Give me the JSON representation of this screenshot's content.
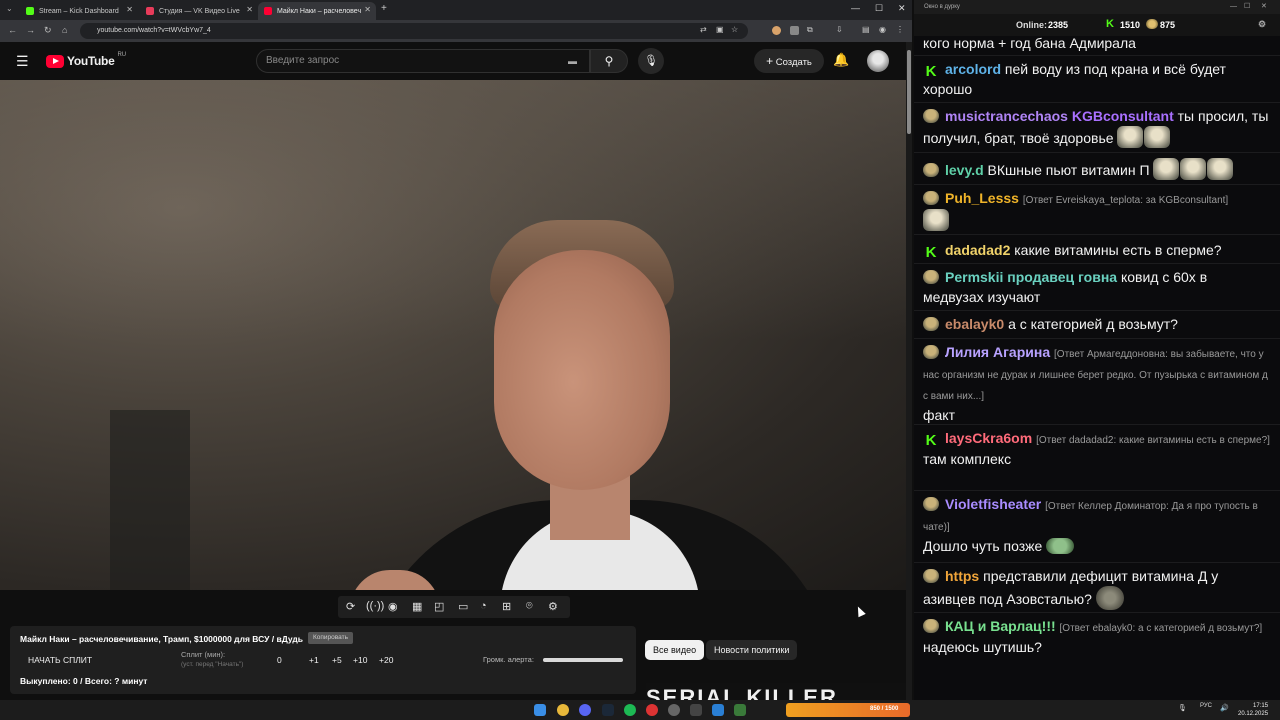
{
  "browser": {
    "tabs": [
      {
        "label": "Stream – Kick Dashboard",
        "favicon_color": "#53fc18"
      },
      {
        "label": "Студия — VK Видео Live",
        "favicon_color": "#e83b5a"
      },
      {
        "label": "Майкл Наки – расчеловеч",
        "favicon_color": "#ff0033"
      }
    ],
    "url": "youtube.com/watch?v=tWVcbYw7_4"
  },
  "youtube": {
    "logo_text": "YouTube",
    "logo_region": "RU",
    "search_placeholder": "Введите запрос",
    "create_label": "Создать"
  },
  "panel": {
    "video_title": "Майкл Наки – расчеловечивание, Трамп, $1000000 для ВСУ / вДудь",
    "copy_label": "Копировать",
    "start_split_label": "НАЧАТЬ СПЛИТ",
    "split_label": "Сплит (мин):",
    "split_hint": "(уст. перед \"Начать\")",
    "split_values": [
      "0",
      "+1",
      "+5",
      "+10",
      "+20"
    ],
    "alert_volume_label": "Громк. алерта:",
    "status_line": "Выкуплено: 0 / Всего: ? минут"
  },
  "chips": {
    "all_videos": "Все видео",
    "politics_news": "Новости политики"
  },
  "thumbnail_text": "SERIAL KILLER",
  "chat": {
    "window_title": "Окно в дурку",
    "online_label": "Online:",
    "online_count": "2385",
    "kick_count": "1510",
    "emote_count": "875",
    "messages": [
      {
        "user": "",
        "text": "кого норма + год бана Адмирала",
        "reply": ""
      },
      {
        "user": "arcolord",
        "text": "пей воду из под крана и всё будет хорошо",
        "reply": ""
      },
      {
        "user": "musictrancechaos",
        "text": "ты просил, ты получил, брат, твоё здоровье",
        "reply": "",
        "mention": "KGBconsultant"
      },
      {
        "user": "levy.d",
        "text": "ВКшные пьют витамин П",
        "reply": ""
      },
      {
        "user": "Puh_Lesss",
        "text": "",
        "reply": "[Ответ Evreiskaya_teplota: за KGBconsultant]"
      },
      {
        "user": "dadadad2",
        "text": "какие витамины есть в сперме?",
        "reply": ""
      },
      {
        "user": "Permskii продавец говна",
        "text": "ковид с 60х в медвузах изучают",
        "reply": ""
      },
      {
        "user": "ebalayk0",
        "text": "а с категорией д возьмут?",
        "reply": ""
      },
      {
        "user": "Лилия Агарина",
        "text": "факт",
        "reply": "[Ответ Армагеддоновна: вы забываете, что у нас организм не дурак и лишнее берет редко. От пузырька с витамином д с вами них...]"
      },
      {
        "user": "laysCkra6om",
        "text": "там комплекс",
        "reply": "[Ответ dadadad2: какие витамины есть в сперме?]"
      },
      {
        "user": "Violetfisheater",
        "text": "Дошло чуть позже",
        "reply": "[Ответ Келлер Доминатор: Да я про тупость в чате)]"
      },
      {
        "user": "https",
        "text": "представили дефицит витамина Д у азивцев под Азовсталью?",
        "reply": ""
      },
      {
        "user": "КАЦ и Варлац!!!",
        "text": "надеюсь шутишь?",
        "reply": "[Ответ ebalayk0: а с категорией д возьмут?]"
      }
    ],
    "colors": {
      "arcolord": "#5fb3e8",
      "musictrancechaos": "#b084f5",
      "mention": "#a970ff",
      "levy": "#5fd0a8",
      "puh": "#f0b429",
      "dadadad2": "#f0d26a",
      "permskii": "#6ad1c0",
      "ebalayk0": "#c88a6a",
      "lilia": "#b8a2ff",
      "lays": "#ff6b7a",
      "violet": "#a98cff",
      "https": "#f0a53a",
      "kac": "#78e08f"
    }
  },
  "taskbar": {
    "lang": "РУС",
    "time": "17:15",
    "date": "20.12.2025",
    "tray_progress": "850 / 1500"
  }
}
